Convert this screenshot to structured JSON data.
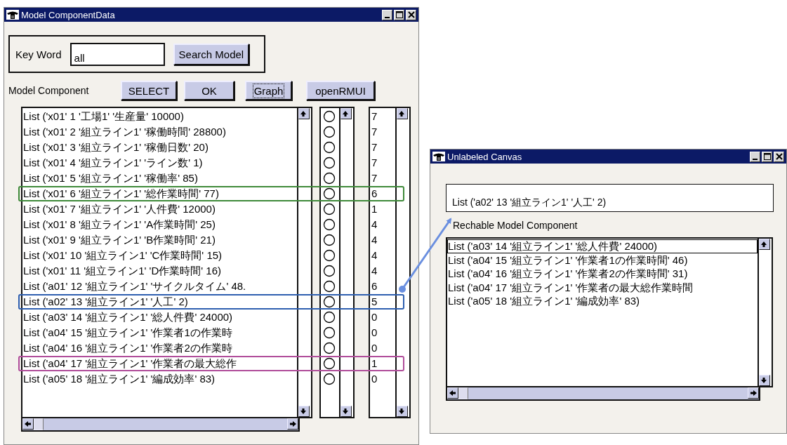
{
  "model_window": {
    "title": "Model ComponentData",
    "keyword": {
      "label": "Key Word",
      "value": "all",
      "button": "Search Model"
    },
    "toolbar": {
      "label": "Model Component",
      "buttons": [
        {
          "label": "SELECT",
          "focused": false
        },
        {
          "label": "OK",
          "focused": false
        },
        {
          "label": "Graph",
          "focused": true
        },
        {
          "label": "openRMUI",
          "focused": false
        }
      ]
    },
    "rows": [
      {
        "text": "List ('x01' 1 '工場1' '生産量' 10000)",
        "value": "7"
      },
      {
        "text": "List ('x01' 2 '組立ライン1' '稼働時間' 28800)",
        "value": "7"
      },
      {
        "text": "List ('x01' 3 '組立ライン1' '稼働日数' 20)",
        "value": "7"
      },
      {
        "text": "List ('x01' 4 '組立ライン1' 'ライン数' 1)",
        "value": "7"
      },
      {
        "text": "List ('x01' 5 '組立ライン1' '稼働率' 85)",
        "value": "7"
      },
      {
        "text": "List ('x01' 6 '組立ライン1' '総作業時間' 77)",
        "value": "6",
        "color": "#3f8a3a"
      },
      {
        "text": "List ('x01' 7 '組立ライン1' '人件費' 12000)",
        "value": "1"
      },
      {
        "text": "List ('x01' 8 '組立ライン1' 'A作業時間' 25)",
        "value": "4"
      },
      {
        "text": "List ('x01' 9 '組立ライン1' 'B作業時間' 21)",
        "value": "4"
      },
      {
        "text": "List ('x01' 10 '組立ライン1' 'C作業時間' 15)",
        "value": "4"
      },
      {
        "text": "List ('x01' 11 '組立ライン1' 'D作業時間' 16)",
        "value": "4"
      },
      {
        "text": "List ('a01' 12 '組立ライン1' 'サイクルタイム' 48.",
        "value": "6"
      },
      {
        "text": "List ('a02' 13 '組立ライン1' '人工' 2)",
        "value": "5",
        "color": "#2e5fb0"
      },
      {
        "text": "List ('a03' 14 '組立ライン1' '総人件費' 24000)",
        "value": "0"
      },
      {
        "text": "List ('a04' 15 '組立ライン1' '作業者1の作業時",
        "value": "0"
      },
      {
        "text": "List ('a04' 16 '組立ライン1' '作業者2の作業時",
        "value": "0"
      },
      {
        "text": "List ('a04' 17 '組立ライン1' '作業者の最大総作",
        "value": "1",
        "color": "#b04d9a"
      },
      {
        "text": "List ('a05' 18 '組立ライン1' '編成効率' 83)",
        "value": "0"
      }
    ]
  },
  "canvas_window": {
    "title": "Unlabeled Canvas",
    "field_value": "List ('a02' 13 '組立ライン1' '人工' 2)",
    "list_label": "Rechable Model Component",
    "items": [
      {
        "text": "List ('a03' 14 '組立ライン1' '総人件費' 24000)",
        "focused": true
      },
      {
        "text": "List ('a04' 15 '組立ライン1' '作業者1の作業時間' 46)",
        "focused": false
      },
      {
        "text": "List ('a04' 16 '組立ライン1' '作業者2の作業時間' 31)",
        "focused": false
      },
      {
        "text": "List ('a04' 17 '組立ライン1' '作業者の最大総作業時間",
        "focused": false
      },
      {
        "text": "List ('a05' 18 '組立ライン1' '編成効率' 83)",
        "focused": false
      }
    ]
  }
}
